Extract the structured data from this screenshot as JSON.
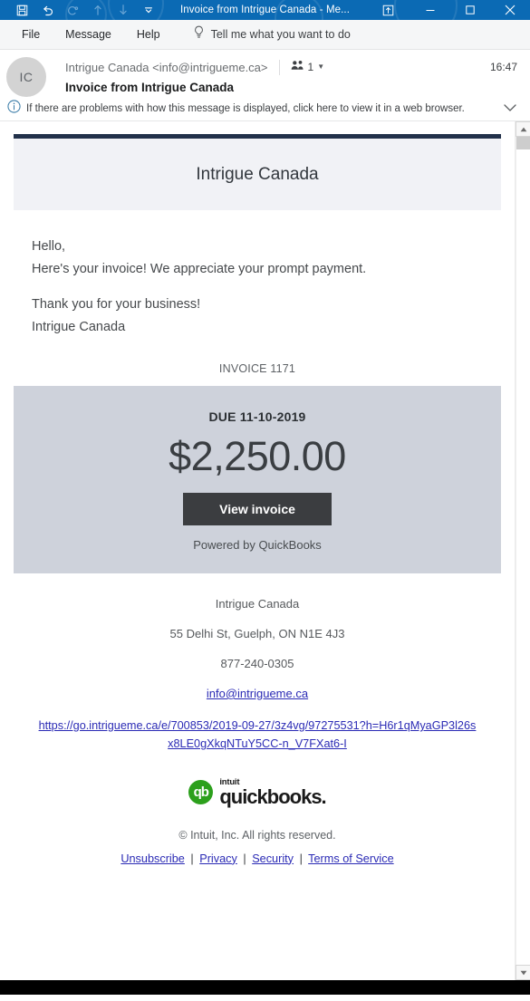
{
  "titlebar": {
    "title": "Invoice from Intrigue Canada  -  Me...",
    "qat": [
      {
        "name": "save-icon",
        "label": "Save"
      },
      {
        "name": "undo-icon",
        "label": "Undo"
      },
      {
        "name": "redo-icon",
        "label": "Redo"
      },
      {
        "name": "previous-item-icon",
        "label": "Previous Item"
      },
      {
        "name": "next-item-icon",
        "label": "Next Item"
      },
      {
        "name": "customize-quick-access-toolbar-icon",
        "label": "Customize Quick Access Toolbar"
      }
    ],
    "controls": [
      {
        "name": "ribbon-display-options-icon",
        "label": "Ribbon Display Options"
      },
      {
        "name": "minimize-icon",
        "label": "Minimize"
      },
      {
        "name": "maximize-icon",
        "label": "Maximize"
      },
      {
        "name": "close-icon",
        "label": "Close"
      }
    ],
    "accent_color": "#0b6ab4"
  },
  "menubar": {
    "items": [
      {
        "label": "File"
      },
      {
        "label": "Message"
      },
      {
        "label": "Help"
      }
    ],
    "tellme": "Tell me what you want to do"
  },
  "message": {
    "avatar_initials": "IC",
    "sender": "Intrigue Canada <info@intrigueme.ca>",
    "recipient_count": "1",
    "time": "16:47",
    "subject": "Invoice from Intrigue Canada",
    "infobar": "If there are problems with how this message is displayed, click here to view it in a web browser."
  },
  "email": {
    "brand_name": "Intrigue Canada",
    "greeting": "Hello,",
    "line1": "Here's your invoice! We appreciate your prompt payment.",
    "line2": "Thank you for your business!",
    "line3": "Intrigue Canada",
    "invoice_number": "INVOICE 1171",
    "due_label": "DUE 11-10-2019",
    "amount": "$2,250.00",
    "cta_label": "View invoice",
    "powered_by": "Powered by QuickBooks",
    "contact": {
      "company": "Intrigue Canada",
      "address": "55 Delhi St, Guelph, ON N1E 4J3",
      "phone": "877-240-0305",
      "email": "info@intrigueme.ca"
    },
    "tracking_link": "https://go.intrigueme.ca/e/700853/2019-09-27/3z4vg/97275531?h=H6r1qMyaGP3l26sx8LE0gXkqNTuY5CC-n_V7FXat6-I",
    "logo": {
      "mark": "qb",
      "intuit": "intuit",
      "wordmark": "quickbooks.",
      "green": "#2ca01c"
    },
    "copyright": "© Intuit, Inc. All rights reserved.",
    "footer_links": [
      {
        "label": "Unsubscribe"
      },
      {
        "label": "Privacy"
      },
      {
        "label": "Security"
      },
      {
        "label": "Terms of Service"
      }
    ],
    "separator": "|",
    "accent_navy": "#22314a",
    "amount_panel_bg": "#ced2db",
    "cta_bg": "#3b3d40"
  }
}
